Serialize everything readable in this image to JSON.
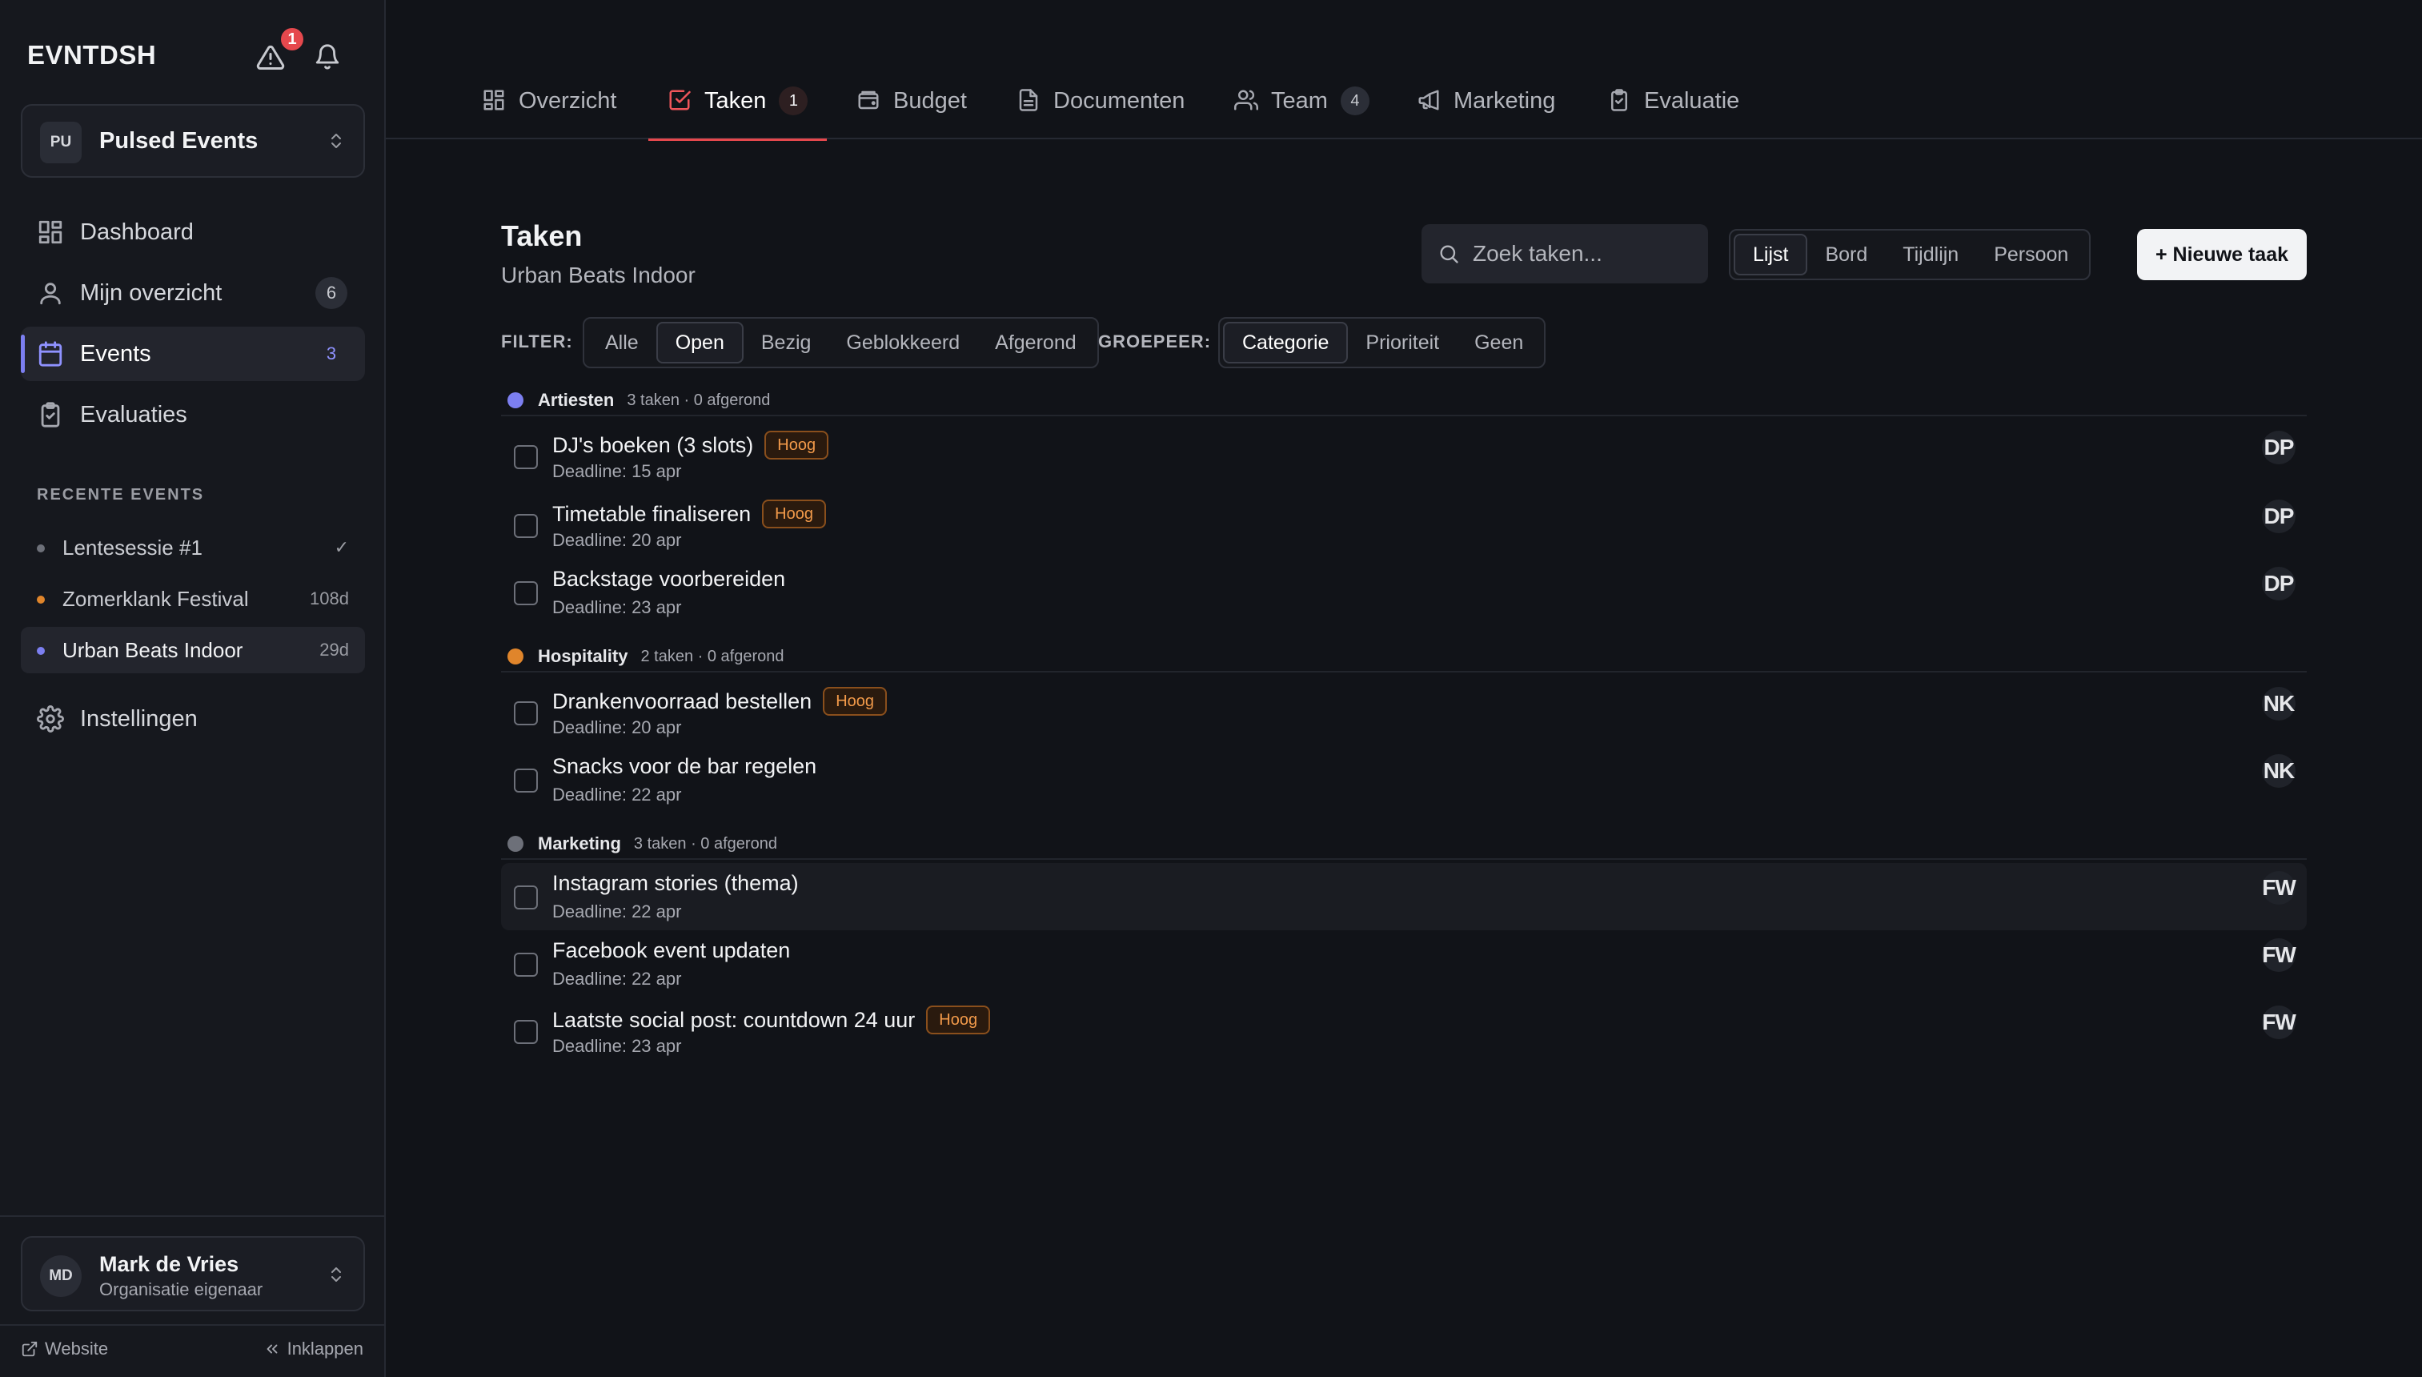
{
  "app": {
    "logo": "EVNTDSH",
    "alert_count": "1"
  },
  "org": {
    "avatar": "PU",
    "name": "Pulsed Events"
  },
  "sidebar": {
    "items": [
      {
        "label": "Dashboard",
        "icon": "dashboard-icon"
      },
      {
        "label": "Mijn overzicht",
        "icon": "user-icon",
        "count": "6"
      },
      {
        "label": "Events",
        "icon": "calendar-icon",
        "count": "3"
      },
      {
        "label": "Evaluaties",
        "icon": "clipboard-icon"
      }
    ],
    "recent_header": "RECENTE EVENTS",
    "recent": [
      {
        "name": "Lentesessie #1",
        "meta": "✓",
        "color": "#6d7079"
      },
      {
        "name": "Zomerklank Festival",
        "meta": "108d",
        "color": "#e0852b"
      },
      {
        "name": "Urban Beats Indoor",
        "meta": "29d",
        "color": "#7c7ff0"
      }
    ],
    "settings_label": "Instellingen",
    "website_label": "Website",
    "collapse_label": "Inklappen"
  },
  "user": {
    "avatar": "MD",
    "name": "Mark de Vries",
    "role": "Organisatie eigenaar"
  },
  "tabs": [
    {
      "label": "Overzicht",
      "icon": "grid-icon"
    },
    {
      "label": "Taken",
      "icon": "check-square-icon",
      "count": "1"
    },
    {
      "label": "Budget",
      "icon": "wallet-icon"
    },
    {
      "label": "Documenten",
      "icon": "document-icon"
    },
    {
      "label": "Team",
      "icon": "users-icon",
      "count": "4"
    },
    {
      "label": "Marketing",
      "icon": "megaphone-icon"
    },
    {
      "label": "Evaluatie",
      "icon": "clipboard-check-icon"
    }
  ],
  "page": {
    "title": "Taken",
    "subtitle": "Urban Beats Indoor"
  },
  "search": {
    "placeholder": "Zoek taken..."
  },
  "views": {
    "options": [
      "Lijst",
      "Bord",
      "Tijdlijn",
      "Persoon"
    ],
    "selected": "Lijst"
  },
  "new_task_label": "+ Nieuwe taak",
  "filter": {
    "label": "FILTER:",
    "options": [
      "Alle",
      "Open",
      "Bezig",
      "Geblokkeerd",
      "Afgerond"
    ],
    "selected": "Open"
  },
  "group_by": {
    "label": "GROEPEER:",
    "options": [
      "Categorie",
      "Prioriteit",
      "Geen"
    ],
    "selected": "Categorie"
  },
  "groups": [
    {
      "name": "Artiesten",
      "meta": "3 taken · 0 afgerond",
      "color": "#7c7ff0",
      "tasks": [
        {
          "title": "DJ's boeken (3 slots)",
          "priority": "Hoog",
          "deadline": "Deadline: 15 apr",
          "assignee": "DP"
        },
        {
          "title": "Timetable finaliseren",
          "priority": "Hoog",
          "deadline": "Deadline: 20 apr",
          "assignee": "DP"
        },
        {
          "title": "Backstage voorbereiden",
          "priority": "",
          "deadline": "Deadline: 23 apr",
          "assignee": "DP"
        }
      ]
    },
    {
      "name": "Hospitality",
      "meta": "2 taken · 0 afgerond",
      "color": "#e0852b",
      "tasks": [
        {
          "title": "Drankenvoorraad bestellen",
          "priority": "Hoog",
          "deadline": "Deadline: 20 apr",
          "assignee": "NK"
        },
        {
          "title": "Snacks voor de bar regelen",
          "priority": "",
          "deadline": "Deadline: 22 apr",
          "assignee": "NK"
        }
      ]
    },
    {
      "name": "Marketing",
      "meta": "3 taken · 0 afgerond",
      "color": "#6d7079",
      "tasks": [
        {
          "title": "Instagram stories (thema)",
          "priority": "",
          "deadline": "Deadline: 22 apr",
          "assignee": "FW"
        },
        {
          "title": "Facebook event updaten",
          "priority": "",
          "deadline": "Deadline: 22 apr",
          "assignee": "FW"
        },
        {
          "title": "Laatste social post: countdown 24 uur",
          "priority": "Hoog",
          "deadline": "Deadline: 23 apr",
          "assignee": "FW"
        }
      ]
    }
  ]
}
